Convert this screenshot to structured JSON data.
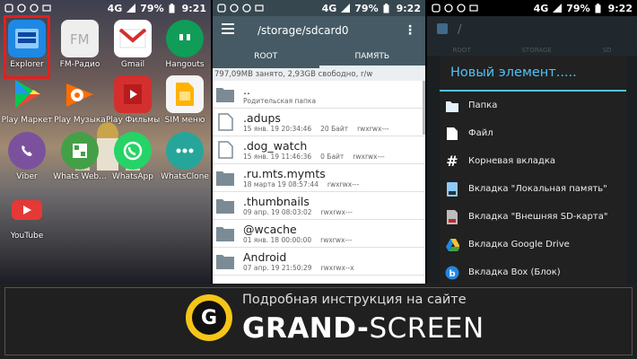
{
  "status": {
    "p1": {
      "network": "4G",
      "battery": "79%",
      "time": "9:21"
    },
    "p2": {
      "network": "4G",
      "battery": "79%",
      "time": "9:22"
    },
    "p3": {
      "network": "4G",
      "battery": "79%",
      "time": "9:22"
    }
  },
  "launcher": {
    "apps": [
      {
        "label": "Explorer",
        "icon": "explorer-icon",
        "color": "#1e88e5"
      },
      {
        "label": "FM-Радио",
        "icon": "fm-radio-icon",
        "color": "#eeeeee"
      },
      {
        "label": "Gmail",
        "icon": "gmail-icon",
        "color": "#ffffff"
      },
      {
        "label": "Hangouts",
        "icon": "hangouts-icon",
        "color": "#0f9d58"
      },
      {
        "label": "Play Маркет",
        "icon": "play-market-icon",
        "color": "#ffffff"
      },
      {
        "label": "Play Музыка",
        "icon": "play-music-icon",
        "color": "#ff6d00"
      },
      {
        "label": "Play Фильмы",
        "icon": "play-movies-icon",
        "color": "#d32f2f"
      },
      {
        "label": "SIM меню",
        "icon": "sim-menu-icon",
        "color": "#f5f5f5"
      },
      {
        "label": "Viber",
        "icon": "viber-icon",
        "color": "#7b519d"
      },
      {
        "label": "Whats Web...",
        "icon": "whats-web-icon",
        "color": "#43a047"
      },
      {
        "label": "WhatsApp",
        "icon": "whatsapp-icon",
        "color": "#25d366"
      },
      {
        "label": "WhatsClone",
        "icon": "whatsclone-icon",
        "color": "#26a69a"
      },
      {
        "label": "YouTube",
        "icon": "youtube-icon",
        "color": "#e53935"
      }
    ]
  },
  "explorer": {
    "path": "/storage/sdcard0",
    "tabs": [
      "ROOT",
      "ПАМЯТЬ"
    ],
    "info": "797,09MB занято, 2,93GB свободно, r/w",
    "rows": [
      {
        "name": "..",
        "date": "Родительская папка",
        "size": "",
        "perm": "",
        "type": "folder"
      },
      {
        "name": ".adups",
        "date": "15 янв. 19 20:34:46",
        "size": "20 Байт",
        "perm": "rwxrwx---",
        "type": "file"
      },
      {
        "name": ".dog_watch",
        "date": "15 янв. 19 11:46:36",
        "size": "0 Байт",
        "perm": "rwxrwx---",
        "type": "file"
      },
      {
        "name": ".ru.mts.mymts",
        "date": "18 марта 19 08:57:44",
        "size": "",
        "perm": "rwxrwx---",
        "type": "folder"
      },
      {
        "name": ".thumbnails",
        "date": "09 апр. 19 08:03:02",
        "size": "",
        "perm": "rwxrwx---",
        "type": "folder"
      },
      {
        "name": "@wcache",
        "date": "01 янв. 18 00:00:00",
        "size": "",
        "perm": "rwxrwx---",
        "type": "folder"
      },
      {
        "name": "Android",
        "date": "07 апр. 19 21:50:29",
        "size": "",
        "perm": "rwxrwx--x",
        "type": "folder"
      }
    ]
  },
  "dialog": {
    "bg_path": "/",
    "bg_tabs": [
      "ROOT",
      "STORAGE",
      "SD"
    ],
    "title": "Новый элемент.....",
    "items": [
      {
        "label": "Папка",
        "icon": "folder-icon"
      },
      {
        "label": "Файл",
        "icon": "file-icon"
      },
      {
        "label": "Корневая вкладка",
        "icon": "hash-icon"
      },
      {
        "label": "Вкладка \"Локальная память\"",
        "icon": "local-storage-icon"
      },
      {
        "label": "Вкладка \"Внешняя SD-карта\"",
        "icon": "sd-card-icon"
      },
      {
        "label": "Вкладка Google Drive",
        "icon": "google-drive-icon"
      },
      {
        "label": "Вкладка Box (Блок)",
        "icon": "box-icon"
      }
    ]
  },
  "banner": {
    "tagline": "Подробная инструкция на сайте",
    "brand_bold": "GRAND-",
    "brand_rest": "SCREEN",
    "logo_letter": "G"
  }
}
